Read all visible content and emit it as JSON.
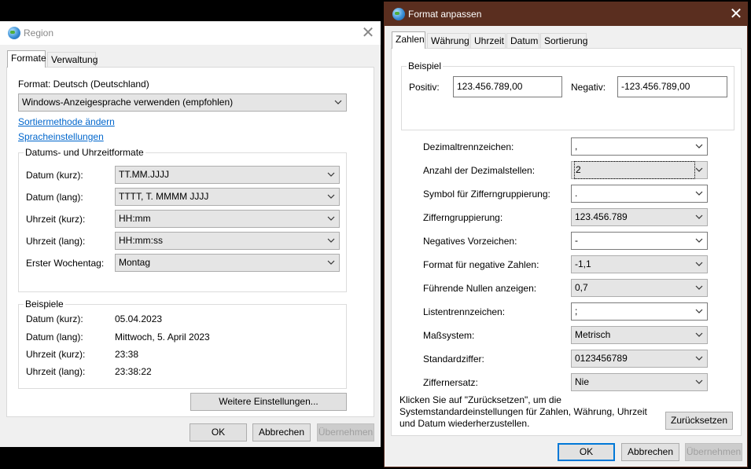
{
  "region": {
    "title": "Region",
    "tabs": [
      "Formate",
      "Verwaltung"
    ],
    "format_label": "Format: Deutsch (Deutschland)",
    "format_select": "Windows-Anzeigesprache verwenden (empfohlen)",
    "link_sort": "Sortiermethode ändern",
    "link_lang": "Spracheinstellungen",
    "date_group_title": "Datums- und Uhrzeitformate",
    "date_rows": [
      {
        "label": "Datum (kurz):",
        "value": "TT.MM.JJJJ"
      },
      {
        "label": "Datum (lang):",
        "value": "TTTT, T. MMMM JJJJ"
      },
      {
        "label": "Uhrzeit (kurz):",
        "value": "HH:mm"
      },
      {
        "label": "Uhrzeit (lang):",
        "value": "HH:mm:ss"
      },
      {
        "label": "Erster Wochentag:",
        "value": "Montag"
      }
    ],
    "examples_title": "Beispiele",
    "examples": [
      {
        "label": "Datum (kurz):",
        "value": "05.04.2023"
      },
      {
        "label": "Datum (lang):",
        "value": "Mittwoch, 5. April 2023"
      },
      {
        "label": "Uhrzeit (kurz):",
        "value": "23:38"
      },
      {
        "label": "Uhrzeit (lang):",
        "value": "23:38:22"
      }
    ],
    "more_settings": "Weitere Einstellungen...",
    "ok": "OK",
    "cancel": "Abbrechen",
    "apply": "Übernehmen"
  },
  "format": {
    "title": "Format anpassen",
    "tabs": [
      "Zahlen",
      "Währung",
      "Uhrzeit",
      "Datum",
      "Sortierung"
    ],
    "example_title": "Beispiel",
    "positive_label": "Positiv:",
    "positive_value": "123.456.789,00",
    "negative_label": "Negativ:",
    "negative_value": "-123.456.789,00",
    "rows": [
      {
        "label": "Dezimaltrennzeichen:",
        "value": ","
      },
      {
        "label": "Anzahl der Dezimalstellen:",
        "value": "2"
      },
      {
        "label": "Symbol für Zifferngruppierung:",
        "value": "."
      },
      {
        "label": "Zifferngruppierung:",
        "value": "123.456.789"
      },
      {
        "label": "Negatives Vorzeichen:",
        "value": "-"
      },
      {
        "label": "Format für negative Zahlen:",
        "value": "-1,1"
      },
      {
        "label": "Führende Nullen anzeigen:",
        "value": "0,7"
      },
      {
        "label": "Listentrennzeichen:",
        "value": ";"
      },
      {
        "label": "Maßsystem:",
        "value": "Metrisch"
      },
      {
        "label": "Standardziffer:",
        "value": "0123456789"
      },
      {
        "label": "Ziffernersatz:",
        "value": "Nie"
      }
    ],
    "hint_line1": "Klicken Sie auf \"Zurücksetzen\", um die",
    "hint_line2": "Systemstandardeinstellungen für Zahlen, Währung, Uhrzeit",
    "hint_line3": "und Datum wiederherzustellen.",
    "reset": "Zurücksetzen",
    "ok": "OK",
    "cancel": "Abbrechen",
    "apply": "Übernehmen"
  },
  "colors": {
    "format_titlebar": "#5a2e1f",
    "link": "#0066cc",
    "accent": "#0078d7"
  },
  "icons": [
    "globe-icon",
    "close-icon",
    "chevron-down-icon"
  ]
}
